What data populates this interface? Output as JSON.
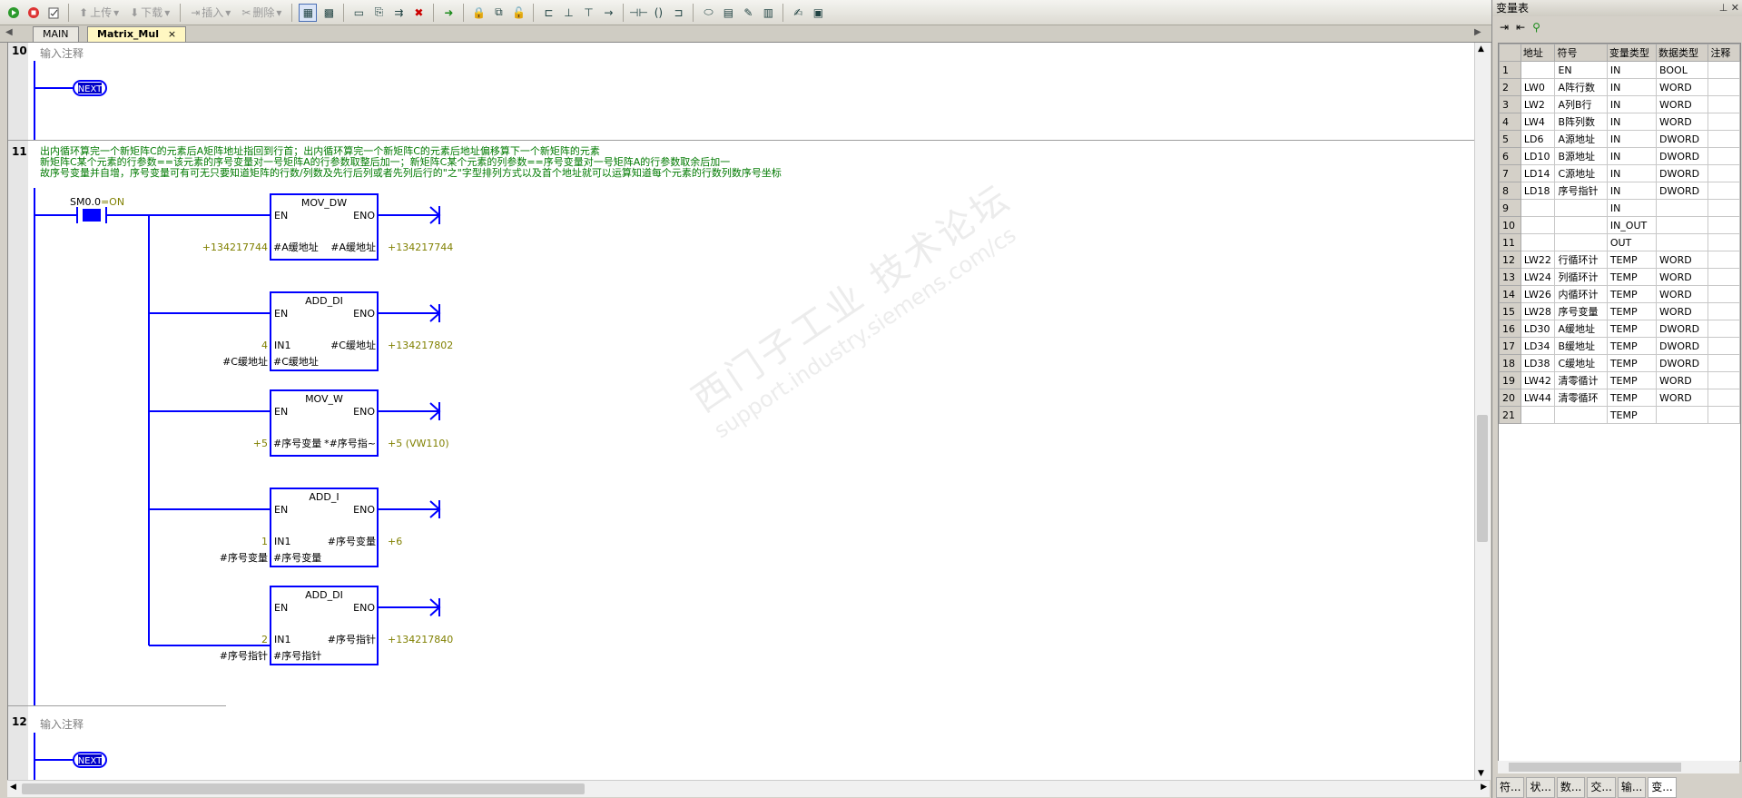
{
  "toolbar": {
    "upload_label": "上传",
    "download_label": "下载",
    "insert_label": "插入",
    "delete_label": "删除"
  },
  "tabs": [
    {
      "label": "MAIN"
    },
    {
      "label": "Matrix_Mul",
      "close": "×"
    }
  ],
  "networks": {
    "n10": {
      "number": "10",
      "comment": "输入注释",
      "coil": "NEXT"
    },
    "n11": {
      "number": "11",
      "comment_lines": [
        "出内循环算完一个新矩阵C的元素后A矩阵地址指回到行首；出内循环算完一个新矩阵C的元素后地址偏移算下一个新矩阵的元素",
        "新矩阵C某个元素的行参数==该元素的序号变量对一号矩阵A的行参数取整后加一；新矩阵C某个元素的列参数==序号变量对一号矩阵A的行参数取余后加一",
        "故序号变量并自增，序号变量可有可无只要知道矩阵的行数/列数及先行后列或者先列后行的\"之\"字型排列方式以及首个地址就可以运算知道每个元素的行数列数序号坐标"
      ],
      "contact": {
        "address": "SM0.0",
        "state": "=ON"
      },
      "blocks": [
        {
          "name": "MOV_DW",
          "en": "EN",
          "eno": "ENO",
          "in1_label": "#A缓地址",
          "in1_value": "+134217744",
          "out_label": "#A缓地址",
          "out_value": "+134217744"
        },
        {
          "name": "ADD_DI",
          "en": "EN",
          "eno": "ENO",
          "in1_label": "IN1",
          "in1_value": "4",
          "in2_label": "#C缓地址",
          "in2_value": "#C缓地址",
          "out_label": "#C缓地址",
          "out_value": "+134217802"
        },
        {
          "name": "MOV_W",
          "en": "EN",
          "eno": "ENO",
          "in1_label": "#序号变量",
          "in1_value": "+5",
          "out_label": "*#序号指~",
          "out_value": "+5 (VW110)"
        },
        {
          "name": "ADD_I",
          "en": "EN",
          "eno": "ENO",
          "in1_label": "IN1",
          "in1_value": "1",
          "in2_label": "#序号变量",
          "in2_value": "#序号变量",
          "out_label": "#序号变量",
          "out_value": "+6"
        },
        {
          "name": "ADD_DI",
          "en": "EN",
          "eno": "ENO",
          "in1_label": "IN1",
          "in1_value": "2",
          "in2_label": "#序号指针",
          "in2_value": "#序号指针",
          "out_label": "#序号指针",
          "out_value": "+134217840"
        }
      ]
    },
    "n12": {
      "number": "12",
      "comment": "输入注释",
      "coil": "NEXT"
    }
  },
  "panel": {
    "title": "变量表",
    "columns": [
      "地址",
      "符号",
      "变量类型",
      "数据类型",
      "注释"
    ],
    "rows": [
      {
        "n": "1",
        "addr": "",
        "sym": "EN",
        "vtype": "IN",
        "dtype": "BOOL"
      },
      {
        "n": "2",
        "addr": "LW0",
        "sym": "A阵行数",
        "vtype": "IN",
        "dtype": "WORD"
      },
      {
        "n": "3",
        "addr": "LW2",
        "sym": "A列B行",
        "vtype": "IN",
        "dtype": "WORD"
      },
      {
        "n": "4",
        "addr": "LW4",
        "sym": "B阵列数",
        "vtype": "IN",
        "dtype": "WORD"
      },
      {
        "n": "5",
        "addr": "LD6",
        "sym": "A源地址",
        "vtype": "IN",
        "dtype": "DWORD"
      },
      {
        "n": "6",
        "addr": "LD10",
        "sym": "B源地址",
        "vtype": "IN",
        "dtype": "DWORD"
      },
      {
        "n": "7",
        "addr": "LD14",
        "sym": "C源地址",
        "vtype": "IN",
        "dtype": "DWORD"
      },
      {
        "n": "8",
        "addr": "LD18",
        "sym": "序号指针",
        "vtype": "IN",
        "dtype": "DWORD"
      },
      {
        "n": "9",
        "addr": "",
        "sym": "",
        "vtype": "IN",
        "dtype": ""
      },
      {
        "n": "10",
        "addr": "",
        "sym": "",
        "vtype": "IN_OUT",
        "dtype": ""
      },
      {
        "n": "11",
        "addr": "",
        "sym": "",
        "vtype": "OUT",
        "dtype": ""
      },
      {
        "n": "12",
        "addr": "LW22",
        "sym": "行循环计",
        "vtype": "TEMP",
        "dtype": "WORD"
      },
      {
        "n": "13",
        "addr": "LW24",
        "sym": "列循环计",
        "vtype": "TEMP",
        "dtype": "WORD"
      },
      {
        "n": "14",
        "addr": "LW26",
        "sym": "内循环计",
        "vtype": "TEMP",
        "dtype": "WORD"
      },
      {
        "n": "15",
        "addr": "LW28",
        "sym": "序号变量",
        "vtype": "TEMP",
        "dtype": "WORD"
      },
      {
        "n": "16",
        "addr": "LD30",
        "sym": "A缓地址",
        "vtype": "TEMP",
        "dtype": "DWORD"
      },
      {
        "n": "17",
        "addr": "LD34",
        "sym": "B缓地址",
        "vtype": "TEMP",
        "dtype": "DWORD"
      },
      {
        "n": "18",
        "addr": "LD38",
        "sym": "C缓地址",
        "vtype": "TEMP",
        "dtype": "DWORD"
      },
      {
        "n": "19",
        "addr": "LW42",
        "sym": "清零循计",
        "vtype": "TEMP",
        "dtype": "WORD"
      },
      {
        "n": "20",
        "addr": "LW44",
        "sym": "清零循环",
        "vtype": "TEMP",
        "dtype": "WORD"
      },
      {
        "n": "21",
        "addr": "",
        "sym": "",
        "vtype": "TEMP",
        "dtype": ""
      }
    ],
    "bottom_tabs": [
      "符...",
      "状...",
      "数...",
      "交...",
      "输...",
      "变..."
    ]
  },
  "watermark": {
    "line1": "西门子工业 技术论坛",
    "line2": "support.industry.siemens.com/cs"
  },
  "colors": {
    "ladder": "#0000ff",
    "value": "#808000",
    "comment": "#007a00"
  }
}
